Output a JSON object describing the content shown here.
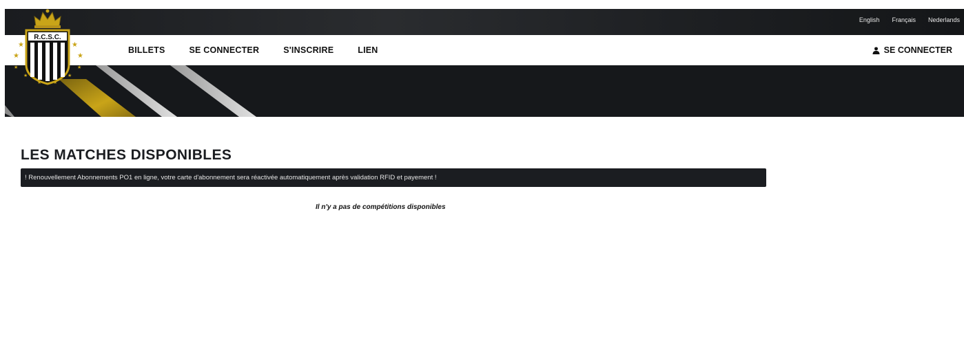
{
  "languages": [
    "English",
    "Français",
    "Nederlands"
  ],
  "logo": {
    "text": "R.C.S.C."
  },
  "nav": {
    "items": [
      "BILLETS",
      "SE CONNECTER",
      "S'INSCRIRE",
      "LIEN"
    ],
    "login_label": "SE CONNECTER",
    "login_icon": "user-icon"
  },
  "main": {
    "title": "LES MATCHES DISPONIBLES",
    "notice": "! Renouvellement Abonnements PO1 en ligne, votre carte d'abonnement sera réactivée automatiquement après validation RFID et payement !",
    "empty_message": "Il n'y a pas de compétitions disponibles"
  },
  "colors": {
    "dark": "#1b1d21",
    "gold": "#c9a418",
    "white": "#ffffff"
  }
}
